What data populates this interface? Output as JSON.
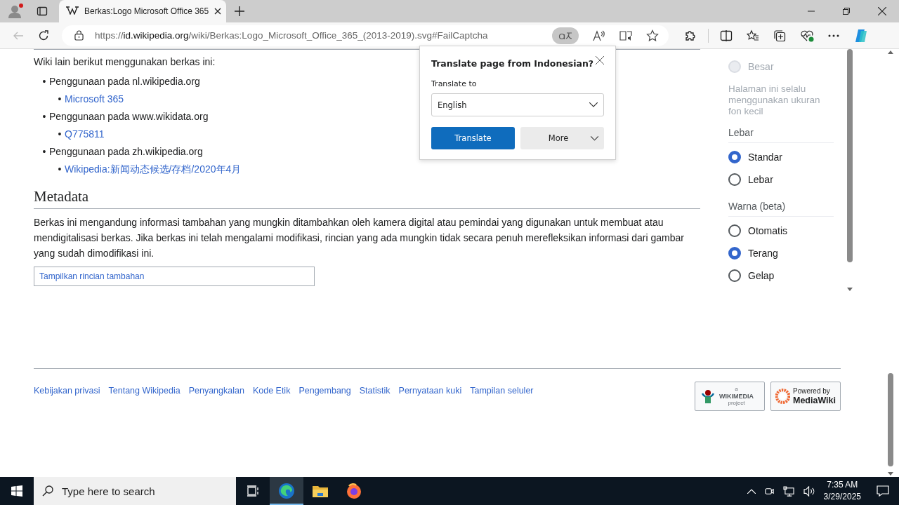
{
  "browser": {
    "tab": {
      "title": "Berkas:Logo Microsoft Office 365",
      "selected": true
    },
    "address": {
      "scheme": "https://",
      "host": "id.wikipedia.org",
      "path": "/wiki/Berkas:Logo_Microsoft_Office_365_(2013-2019).svg#FailCaptcha"
    }
  },
  "translate_popup": {
    "title": "Translate page from Indonesian?",
    "label": "Translate to",
    "language": "English",
    "primary_button": "Translate",
    "secondary_button": "More"
  },
  "article": {
    "intro": "Wiki lain berikut menggunakan berkas ini:",
    "usage": [
      {
        "bullet": "•",
        "text": "Penggunaan pada nl.wikipedia.org",
        "children": [
          {
            "bullet": "•",
            "text": "Microsoft 365"
          }
        ]
      },
      {
        "bullet": "•",
        "text": "Penggunaan pada www.wikidata.org",
        "children": [
          {
            "bullet": "•",
            "text": "Q775811"
          }
        ]
      },
      {
        "bullet": "•",
        "text": "Penggunaan pada zh.wikipedia.org",
        "children": [
          {
            "bullet": "•",
            "text": "Wikipedia:新闻动态候选/存档/2020年4月"
          }
        ]
      }
    ],
    "heading": "Metadata",
    "paragraph": "Berkas ini mengandung informasi tambahan yang mungkin ditambahkan oleh kamera digital atau pemindai yang digunakan untuk membuat atau mendigitalisasi berkas. Jika berkas ini telah mengalami modifikasi, rincian yang ada mungkin tidak secara penuh merefleksikan informasi dari gambar yang sudah dimodifikasi ini.",
    "toggle": "Tampilkan rincian tambahan"
  },
  "sidebar": {
    "size_options": [
      {
        "label": "Besar",
        "selected": false,
        "disabled": true
      }
    ],
    "size_note": "Halaman ini selalu menggunakan ukuran fon kecil",
    "sections": [
      {
        "title": "Lebar",
        "options": [
          {
            "label": "Standar",
            "selected": true,
            "disabled": false
          },
          {
            "label": "Lebar",
            "selected": false,
            "disabled": false
          }
        ]
      },
      {
        "title": "Warna (beta)",
        "options": [
          {
            "label": "Otomatis",
            "selected": false,
            "disabled": false
          },
          {
            "label": "Terang",
            "selected": true,
            "disabled": false
          },
          {
            "label": "Gelap",
            "selected": false,
            "disabled": false
          }
        ]
      }
    ]
  },
  "footer": {
    "links": [
      "Kebijakan privasi",
      "Tentang Wikipedia",
      "Penyangkalan",
      "Kode Etik",
      "Pengembang",
      "Statistik",
      "Pernyataan kuki",
      "Tampilan seluler"
    ],
    "wikimedia_badge": {
      "small": "a",
      "name": "WIKIMEDIA",
      "sub": "project"
    },
    "mediawiki_badge": {
      "line1": "Powered by",
      "line2": "MediaWiki"
    }
  },
  "taskbar": {
    "search_placeholder": "Type here to search",
    "time": "7:35 AM",
    "date": "3/29/2025"
  }
}
